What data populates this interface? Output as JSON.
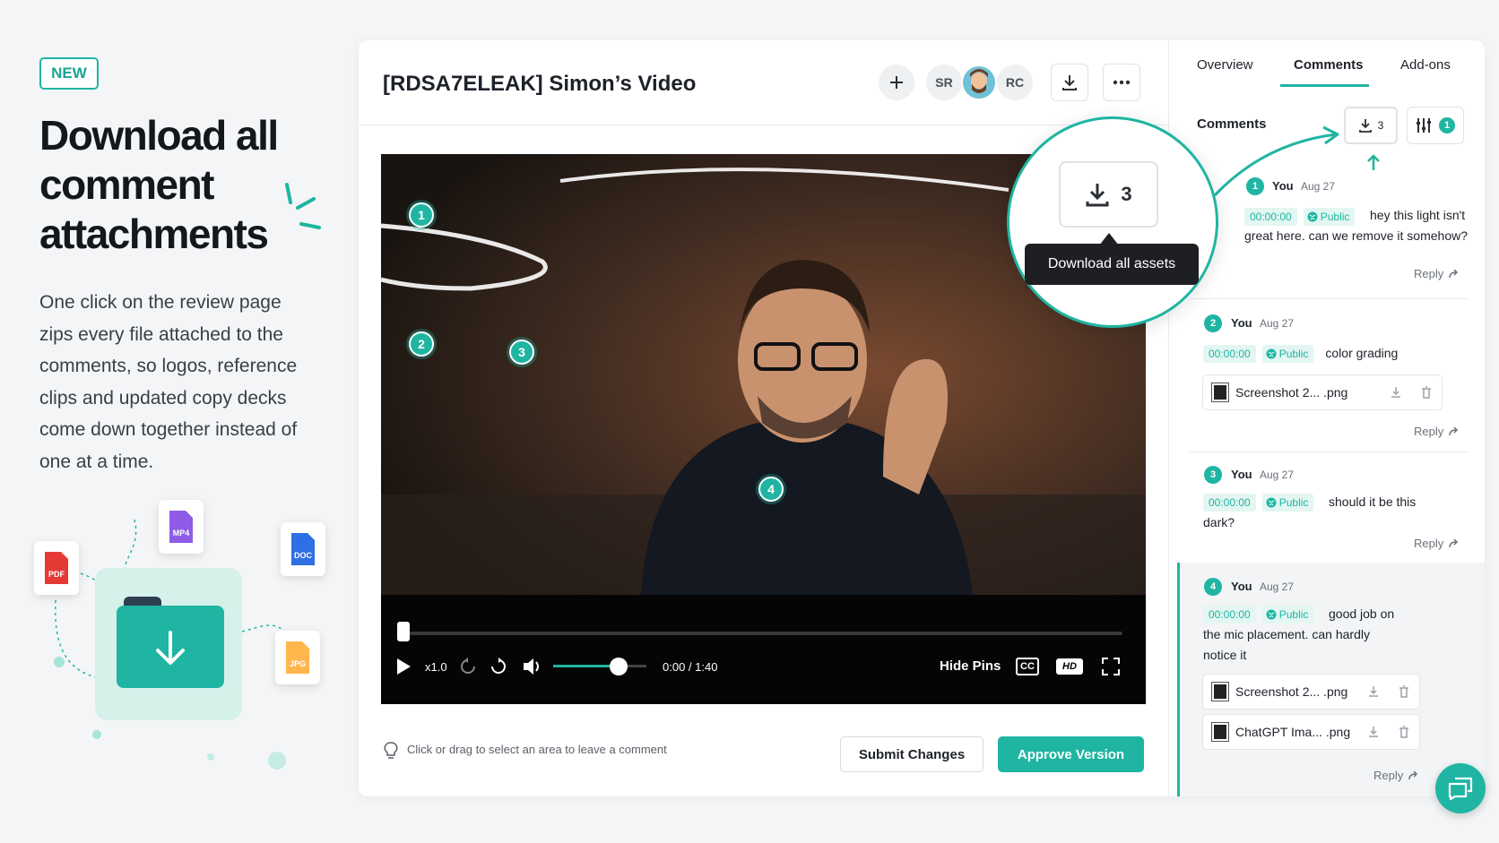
{
  "promo": {
    "badge": "NEW",
    "headline": "Download all comment attachments",
    "description": "One click on the review page zips every file attached to the comments, so logos, reference clips and updated copy decks come down together instead of one at a time.",
    "file_types": [
      "PDF",
      "MP4",
      "DOC",
      "JPG"
    ]
  },
  "header": {
    "title": "[RDSA7ELEAK] Simon’s Video",
    "avatars": [
      "SR",
      "RC"
    ]
  },
  "video": {
    "pins": [
      "1",
      "2",
      "3",
      "4"
    ],
    "speed": "x1.0",
    "time": "0:00 / 1:40",
    "hide_pins_label": "Hide Pins",
    "cc_label": "CC",
    "hd_label": "HD",
    "progress": 0,
    "volume": 0.7
  },
  "footer": {
    "hint": "Click or drag to select an area to leave a comment",
    "submit_label": "Submit Changes",
    "approve_label": "Approve Version"
  },
  "tooltip": {
    "text": "Download all assets",
    "count": "3"
  },
  "panel": {
    "tabs": [
      "Overview",
      "Comments",
      "Add-ons"
    ],
    "active_tab": "Comments",
    "heading": "Comments",
    "download_count": "3",
    "filter_count": "1",
    "comments": [
      {
        "num": "1",
        "user": "You",
        "date": "Aug 27",
        "timestamp": "00:00:00",
        "visibility": "Public",
        "text": "hey this light isn't great here. can we remove it somehow?",
        "reply": "Reply"
      },
      {
        "num": "2",
        "user": "You",
        "date": "Aug 27",
        "timestamp": "00:00:00",
        "visibility": "Public",
        "text": "color grading",
        "attachments": [
          "Screenshot 2... .png"
        ],
        "reply": "Reply"
      },
      {
        "num": "3",
        "user": "You",
        "date": "Aug 27",
        "timestamp": "00:00:00",
        "visibility": "Public",
        "text": "should it be this dark?",
        "reply": "Reply"
      },
      {
        "num": "4",
        "user": "You",
        "date": "Aug 27",
        "timestamp": "00:00:00",
        "visibility": "Public",
        "text": "good job on the mic placement. can hardly notice it",
        "attachments": [
          "Screenshot 2... .png",
          "ChatGPT Ima... .png"
        ],
        "reply": "Reply"
      }
    ]
  },
  "colors": {
    "accent": "#1fb5a2",
    "dark": "#1d2129"
  }
}
